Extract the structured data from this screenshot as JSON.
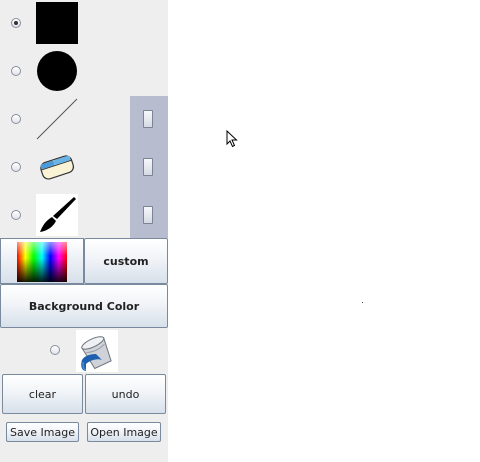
{
  "tools": [
    {
      "name": "rectangle-tool",
      "selected": true,
      "icon": "filled-square-icon"
    },
    {
      "name": "oval-tool",
      "selected": false,
      "icon": "filled-circle-icon"
    },
    {
      "name": "line-tool",
      "selected": false,
      "icon": "diagonal-line-icon"
    },
    {
      "name": "eraser-tool",
      "selected": false,
      "icon": "eraser-icon"
    },
    {
      "name": "brush-tool",
      "selected": false,
      "icon": "paintbrush-icon"
    }
  ],
  "fill_tool": {
    "selected": false,
    "icon": "paint-bucket-icon"
  },
  "color": {
    "custom_label": "custom",
    "background_label": "Background Color"
  },
  "actions": {
    "clear_label": "clear",
    "undo_label": "undo",
    "save_label": "Save Image",
    "open_label": "Open Image"
  },
  "colors": {
    "sidebar_bg": "#eeeeee",
    "size_panel": "#b8bccf",
    "canvas_bg": "#ffffff"
  }
}
